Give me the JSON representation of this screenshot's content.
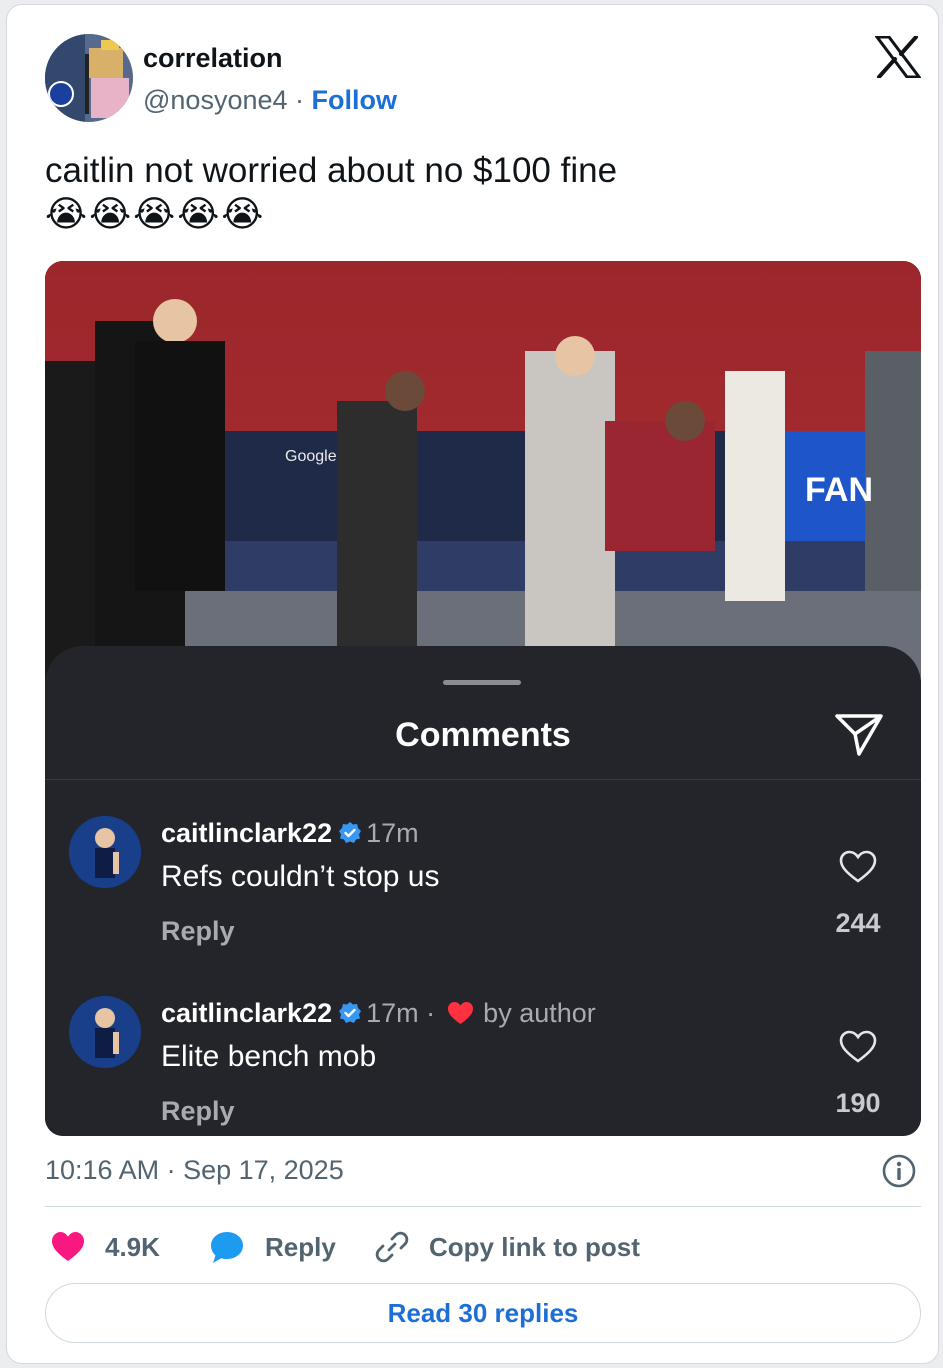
{
  "author": {
    "name": "correlation",
    "handle": "@nosyone4",
    "separator": "·",
    "follow_label": "Follow"
  },
  "tweet": {
    "text": "caitlin not worried about no $100 fine",
    "emojis": "😭😭😭😭😭"
  },
  "media": {
    "sheet_title": "Comments",
    "comments": [
      {
        "username": "caitlinclark22",
        "time": "17m",
        "separator": "",
        "badge": "",
        "text": "Refs couldn’t stop us",
        "reply_label": "Reply",
        "like_count": "244"
      },
      {
        "username": "caitlinclark22",
        "time": "17m",
        "separator": "·",
        "badge": "by author",
        "text": "Elite bench mob",
        "reply_label": "Reply",
        "like_count": "190"
      }
    ]
  },
  "footer": {
    "timestamp": "10:16 AM · Sep 17, 2025",
    "like_count": "4.9K",
    "reply_label": "Reply",
    "copy_label": "Copy link to post",
    "read_replies_label": "Read 30 replies"
  },
  "colors": {
    "accent": "#1d6fd6",
    "like": "#f91880",
    "reply": "#1d9bf0",
    "sheet_bg": "#23252b",
    "verified": "#3897f0",
    "author_heart": "#ff3040"
  }
}
